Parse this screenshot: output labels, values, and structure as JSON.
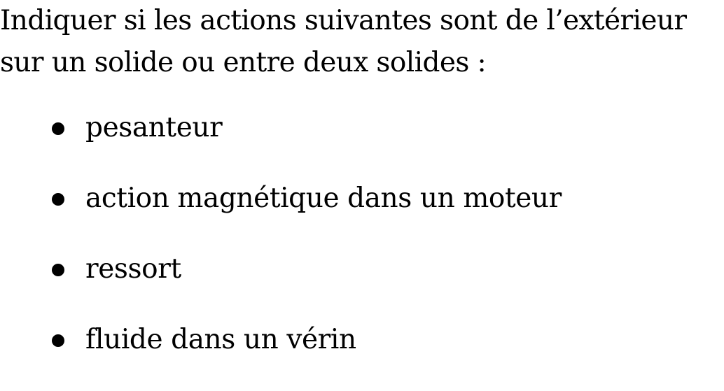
{
  "intro": {
    "line1": "Indiquer si les actions suivantes sont de l’extérieur",
    "line2": "sur un solide ou entre deux solides :"
  },
  "items": [
    "pesanteur",
    "action magnétique dans un moteur",
    "ressort",
    "fluide dans un vérin"
  ]
}
